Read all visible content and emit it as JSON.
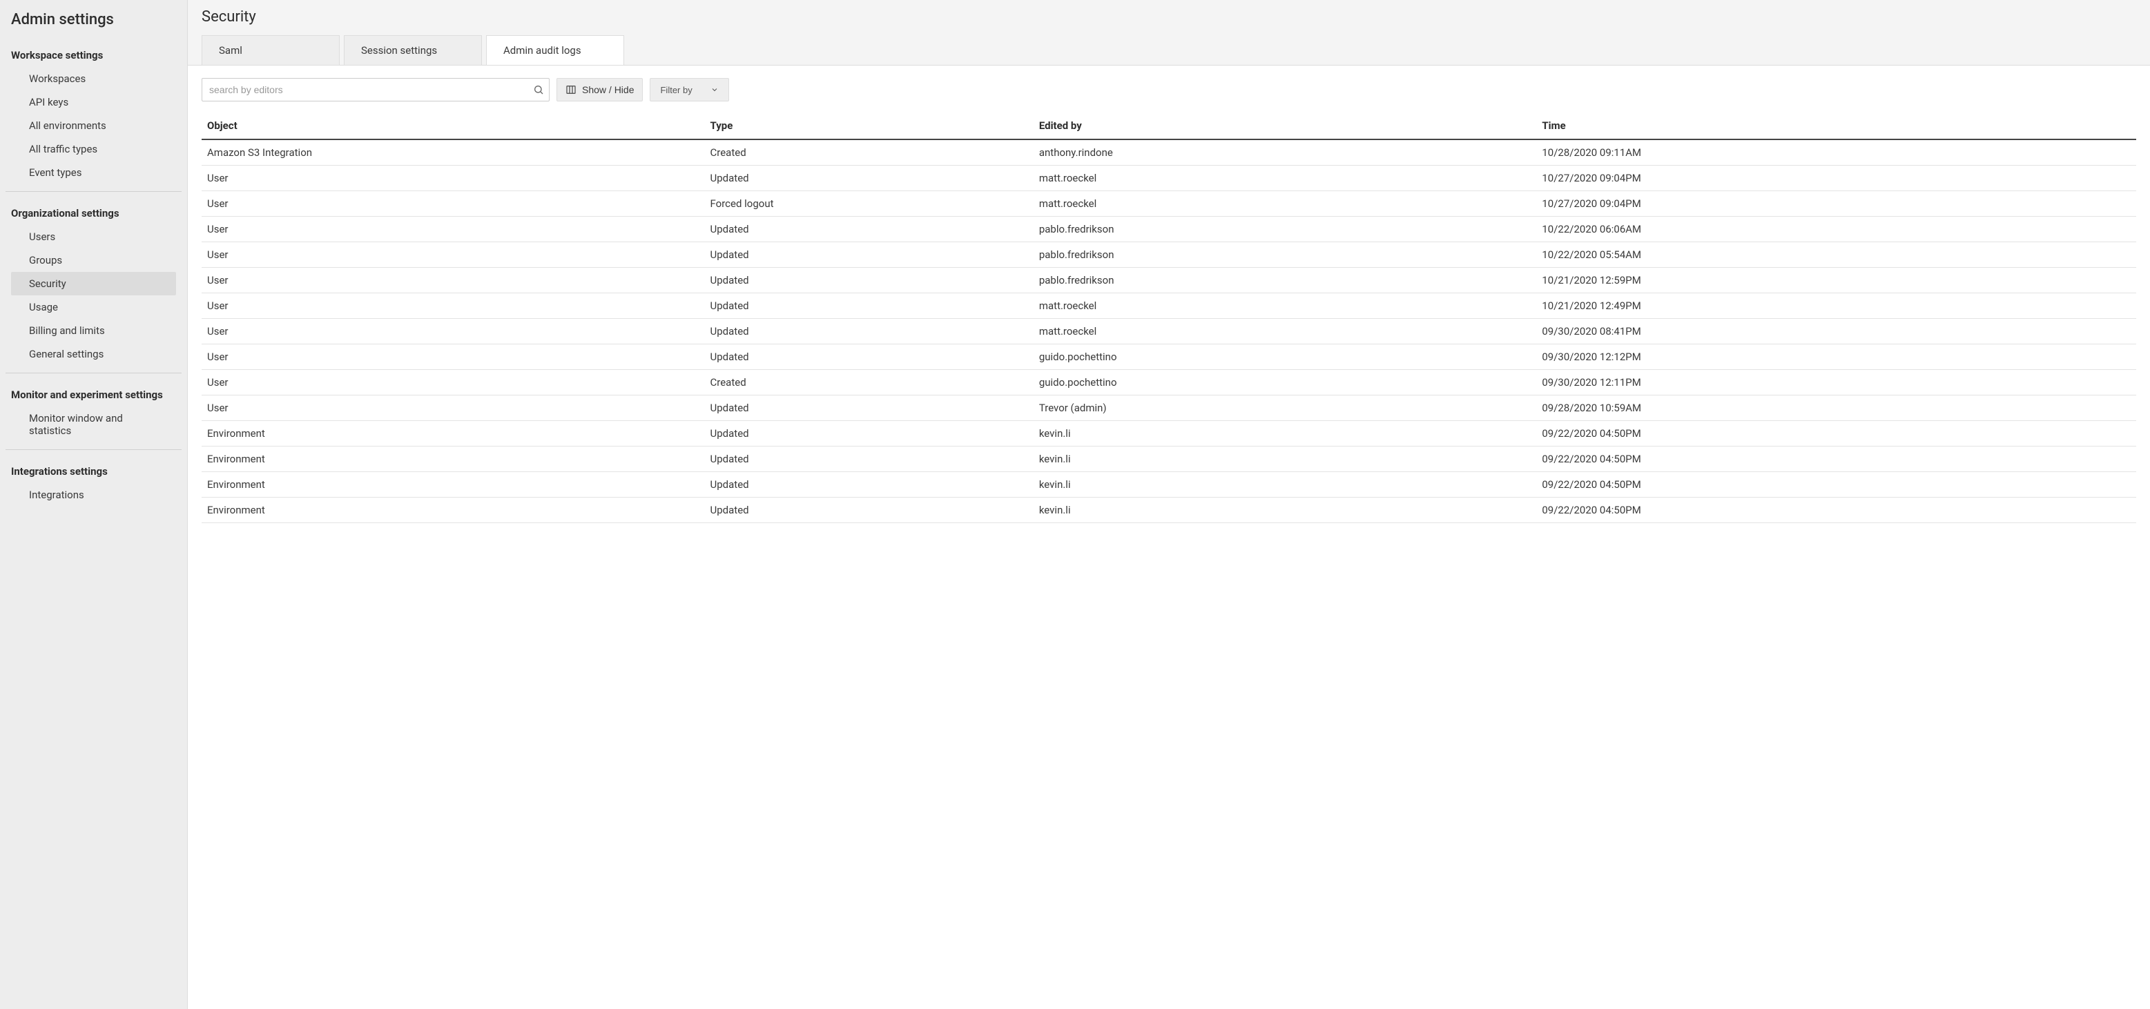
{
  "sidebar": {
    "title": "Admin settings",
    "sections": [
      {
        "heading": "Workspace settings",
        "items": [
          {
            "label": "Workspaces",
            "id": "workspaces"
          },
          {
            "label": "API keys",
            "id": "api-keys"
          },
          {
            "label": "All environments",
            "id": "all-environments"
          },
          {
            "label": "All traffic types",
            "id": "all-traffic-types"
          },
          {
            "label": "Event types",
            "id": "event-types"
          }
        ]
      },
      {
        "heading": "Organizational settings",
        "items": [
          {
            "label": "Users",
            "id": "users"
          },
          {
            "label": "Groups",
            "id": "groups"
          },
          {
            "label": "Security",
            "id": "security",
            "active": true
          },
          {
            "label": "Usage",
            "id": "usage"
          },
          {
            "label": "Billing and limits",
            "id": "billing-and-limits"
          },
          {
            "label": "General settings",
            "id": "general-settings"
          }
        ]
      },
      {
        "heading": "Monitor and experiment settings",
        "items": [
          {
            "label": "Monitor window and statistics",
            "id": "monitor-window-and-statistics"
          }
        ]
      },
      {
        "heading": "Integrations settings",
        "items": [
          {
            "label": "Integrations",
            "id": "integrations"
          }
        ]
      }
    ]
  },
  "page": {
    "title": "Security"
  },
  "tabs": [
    {
      "label": "Saml",
      "id": "saml"
    },
    {
      "label": "Session settings",
      "id": "session-settings"
    },
    {
      "label": "Admin audit logs",
      "id": "admin-audit-logs",
      "active": true
    }
  ],
  "controls": {
    "search_placeholder": "search by editors",
    "show_hide_label": "Show / Hide",
    "filter_label": "Filter by"
  },
  "table": {
    "columns": [
      "Object",
      "Type",
      "Edited by",
      "Time"
    ],
    "rows": [
      {
        "object": "Amazon S3 Integration",
        "type": "Created",
        "edited_by": "anthony.rindone",
        "time": "10/28/2020 09:11AM"
      },
      {
        "object": "User",
        "type": "Updated",
        "edited_by": "matt.roeckel",
        "time": "10/27/2020 09:04PM"
      },
      {
        "object": "User",
        "type": "Forced logout",
        "edited_by": "matt.roeckel",
        "time": "10/27/2020 09:04PM"
      },
      {
        "object": "User",
        "type": "Updated",
        "edited_by": "pablo.fredrikson",
        "time": "10/22/2020 06:06AM"
      },
      {
        "object": "User",
        "type": "Updated",
        "edited_by": "pablo.fredrikson",
        "time": "10/22/2020 05:54AM"
      },
      {
        "object": "User",
        "type": "Updated",
        "edited_by": "pablo.fredrikson",
        "time": "10/21/2020 12:59PM"
      },
      {
        "object": "User",
        "type": "Updated",
        "edited_by": "matt.roeckel",
        "time": "10/21/2020 12:49PM"
      },
      {
        "object": "User",
        "type": "Updated",
        "edited_by": "matt.roeckel",
        "time": "09/30/2020 08:41PM"
      },
      {
        "object": "User",
        "type": "Updated",
        "edited_by": "guido.pochettino",
        "time": "09/30/2020 12:12PM"
      },
      {
        "object": "User",
        "type": "Created",
        "edited_by": "guido.pochettino",
        "time": "09/30/2020 12:11PM"
      },
      {
        "object": "User",
        "type": "Updated",
        "edited_by": "Trevor (admin)",
        "time": "09/28/2020 10:59AM"
      },
      {
        "object": "Environment",
        "type": "Updated",
        "edited_by": "kevin.li",
        "time": "09/22/2020 04:50PM"
      },
      {
        "object": "Environment",
        "type": "Updated",
        "edited_by": "kevin.li",
        "time": "09/22/2020 04:50PM"
      },
      {
        "object": "Environment",
        "type": "Updated",
        "edited_by": "kevin.li",
        "time": "09/22/2020 04:50PM"
      },
      {
        "object": "Environment",
        "type": "Updated",
        "edited_by": "kevin.li",
        "time": "09/22/2020 04:50PM"
      }
    ]
  }
}
